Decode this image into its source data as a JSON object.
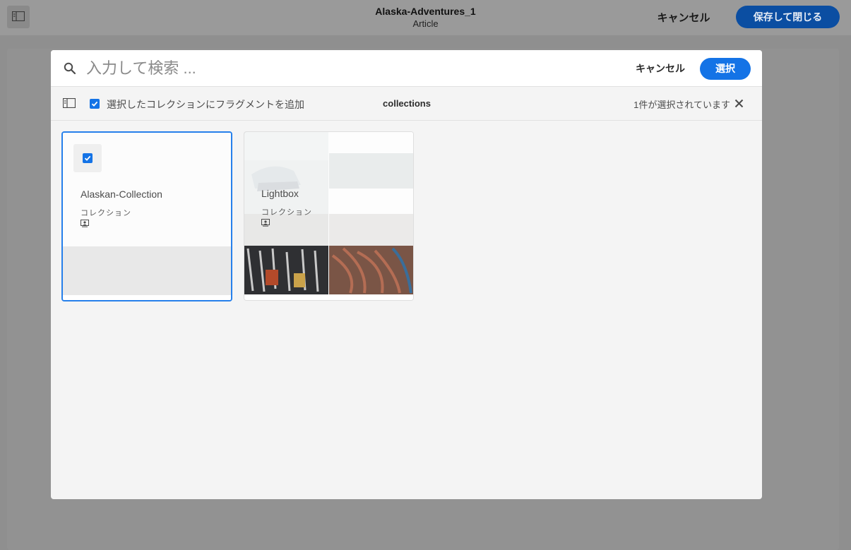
{
  "app": {
    "title": "Alaska-Adventures_1",
    "subtitle": "Article",
    "cancel_label": "キャンセル",
    "save_close_label": "保存して閉じる"
  },
  "dialog": {
    "search": {
      "placeholder": "入力して検索 ...",
      "value": ""
    },
    "cancel_label": "キャンセル",
    "select_label": "選択",
    "toolbar": {
      "add_to_collection_label": "選択したコレクションにフラグメントを追加",
      "add_to_collection_checked": true,
      "location": "collections",
      "selection_count": "1件が選択されています"
    },
    "cards": [
      {
        "title": "Alaskan-Collection",
        "type": "コレクション",
        "selected": true,
        "icon": "collection-icon"
      },
      {
        "title": "Lightbox",
        "type": "コレクション",
        "selected": false,
        "icon": "collection-icon"
      }
    ]
  },
  "colors": {
    "accent": "#1473e6",
    "save_button": "#0b4ea2",
    "selection_border": "#2680eb"
  }
}
